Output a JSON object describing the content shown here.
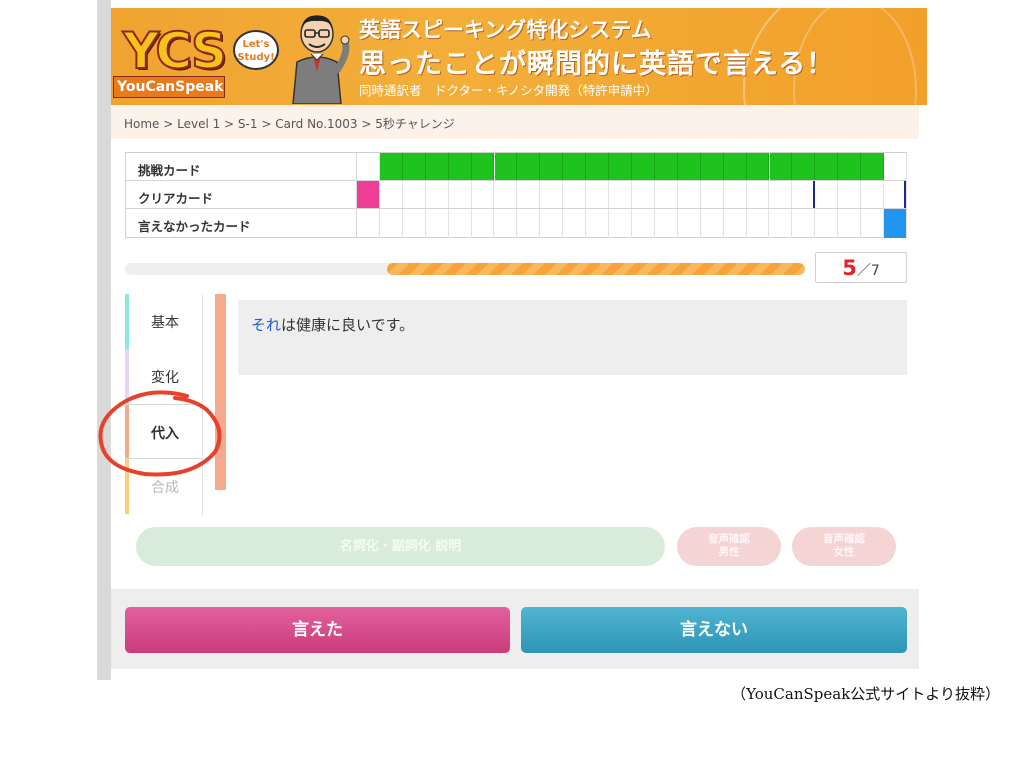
{
  "header": {
    "logo_main": "YCS",
    "logo_sub": "YouCanSpeak",
    "bubble_line1": "Let's",
    "bubble_line2": "Study!",
    "title_line1": "英語スピーキング特化システム",
    "title_line2": "思ったことが瞬間的に英語で言える！",
    "subtitle": "同時通訳者　ドクター・キノシタ開発（特許申請中）",
    "colors": {
      "background": "#f2a330",
      "logo_fill": "#f7c21b"
    }
  },
  "breadcrumb": "Home > Level 1 > S-1 > Card No.1003 > 5秒チャレンジ",
  "card_grid": {
    "rows": [
      {
        "label": "挑戦カード"
      },
      {
        "label": "クリアカード"
      },
      {
        "label": "言えなかったカード"
      }
    ],
    "columns": 24,
    "challenge_filled": [
      1,
      22
    ],
    "clear_marker_index": 0,
    "not_said_marker_index": 23,
    "colors": {
      "challenge": "#1ec31e",
      "clear": "#ee3d96",
      "not_said": "#2195f0",
      "line": "#1a2a8a"
    }
  },
  "progress": {
    "current": "5",
    "total": "／7",
    "fill_start_fraction": 0.385,
    "fill_end_fraction": 1.0,
    "color": "#f7a33a"
  },
  "tabs": [
    {
      "label": "基本",
      "state": "normal",
      "color": "#8de8e0"
    },
    {
      "label": "変化",
      "state": "normal",
      "color": "#e6d2f2"
    },
    {
      "label": "代入",
      "state": "active",
      "color": "#f6a98c"
    },
    {
      "label": "合成",
      "state": "faded",
      "color": "#f7cf7a"
    }
  ],
  "sentence": {
    "highlight": "それ",
    "rest": "は健康に良いです。"
  },
  "buttons": {
    "explanation": "名詞化・副詞化 説明",
    "voice_male_line1": "音声確認",
    "voice_male_line2": "男性",
    "voice_female_line1": "音声確認",
    "voice_female_line2": "女性",
    "said": "言えた",
    "not_said": "言えない"
  },
  "credit": "（YouCanSpeak公式サイトより抜粋）"
}
